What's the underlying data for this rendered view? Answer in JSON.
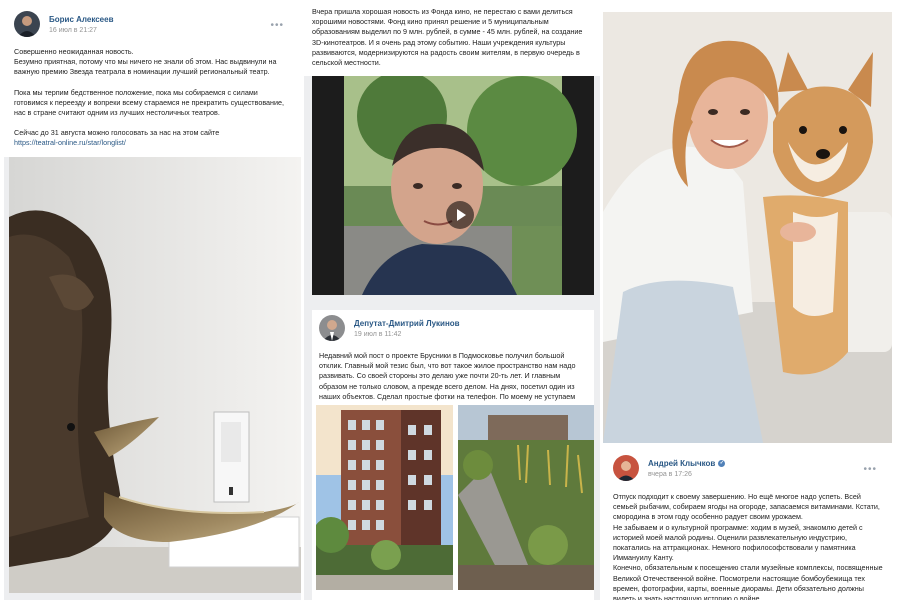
{
  "post1": {
    "author": "Борис Алексеев",
    "time": "16 июл в 21:27",
    "more": "•••",
    "paragraphs": [
      "Совершенно неожиданная новость.",
      "Безумно приятная, потому что мы ничего не знали об этом. Нас выдвинули на важную премию Звезда театрала в номинации лучший региональный театр.",
      "",
      "Пока мы терпим бедственное положение, пока мы собираемся с силами готовимся к переезду и вопреки всему стараемся не прекратить существование, нас в стране считают одним из лучших нестоличных театров.",
      "",
      "Сейчас до 31 августа можно голосовать за нас на этом сайте"
    ],
    "link": "https://teatral-online.ru/star/longlist/"
  },
  "post2": {
    "text": "Вчера пришла хорошая новость из Фонда кино, не перестаю с вами делиться хорошими новостями. Фонд кино принял решение и 5 муниципальным образованиям выделил по 9 млн. рублей, в сумме - 45 млн. рублей, на создание 3D-кинотеатров. И я очень рад этому событию. Наши учреждения культуры развиваются, модернизируются на радость своим жителям, в первую очередь в сельской местности."
  },
  "post3": {
    "author": "Депутат-Дмитрий Лукинов",
    "time": "19 июл в 11:42",
    "text": "Недавний мой пост о проекте Брусники в Подмосковье получил большой отклик. Главный мой тезис был, что вот такое жилое пространство нам надо развивать. Со своей стороны это делаю уже почти 20-ть лет. И главным образом не только словом, а прежде всего делом. На днях, посетил один из наших объектов. Сделал простые фотки на телефон. По моему не уступаем коллегам из других регионов."
  },
  "post4": {
    "author": "Андрей Клычков",
    "time": "вчера в 17:26",
    "more": "•••",
    "verified": "✓",
    "paragraphs": [
      "Отпуск подходит к своему завершению. Но ещё многое надо успеть. Всей семьей рыбачим, собираем ягоды на огороде, запасаемся витаминами. Кстати, смородина в этом году особенно радует своим урожаем.",
      "Не забываем и о культурной программе: ходим в музей, знакомлю детей с историей моей малой родины. Оценили развлекательную индустрию, покатались на аттракционах. Немного пофилософствовали у памятника Иммануилу Канту.",
      "Конечно, обязательным к посещению стали музейные комплексы, посвященные Великой Отечественной войне. Посмотрели настоящие бомбоубежища тех времен, фотографии, карты, военные диорамы. Дети обязательно должны видеть и знать настоящую историю о войне."
    ]
  },
  "colors": {
    "link": "#2a5885",
    "muted": "#939393",
    "feed_bg": "#edeef0"
  },
  "icons": [
    "avatar",
    "more-icon",
    "play-icon",
    "verified-icon"
  ]
}
